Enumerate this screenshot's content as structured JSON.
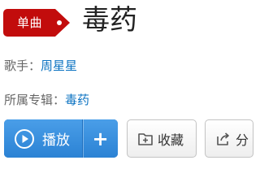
{
  "badge": {
    "label": "单曲"
  },
  "song": {
    "title": "毒药"
  },
  "artist": {
    "label": "歌手：",
    "name": "周星星"
  },
  "album": {
    "label": "所属专辑：",
    "name": "毒药"
  },
  "actions": {
    "play_label": "播放",
    "add_label": "+",
    "collect_label": "收藏",
    "share_label": "分"
  },
  "colors": {
    "badge_red": "#c20c0c",
    "link_blue": "#0c73c2",
    "play_blue": "#2b82d4"
  },
  "icons": {
    "play": "play-circle-icon",
    "collect": "folder-plus-icon",
    "share": "share-icon"
  }
}
